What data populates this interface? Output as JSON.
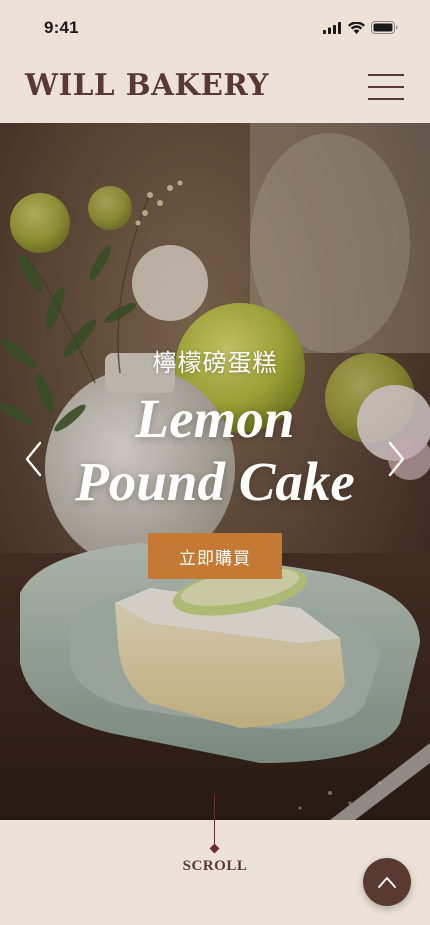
{
  "status_bar": {
    "time": "9:41",
    "icons": [
      "cellular-signal-icon",
      "wifi-icon",
      "battery-icon"
    ]
  },
  "header": {
    "logo": "WILL BAKERY",
    "menu_icon": "hamburger-menu-icon"
  },
  "hero": {
    "subtitle": "檸檬磅蛋糕",
    "title_line1": "Lemon",
    "title_line2": "Pound Cake",
    "cta_label": "立即購買",
    "prev_icon": "chevron-left-icon",
    "next_icon": "chevron-right-icon"
  },
  "scroll_indicator": {
    "label": "SCROLL"
  },
  "back_to_top": {
    "icon": "chevron-up-icon"
  },
  "colors": {
    "background": "#ece2d8",
    "brand_brown": "#5a3a30",
    "cta_orange": "#c47a35",
    "scroll_line": "#6e2f2f"
  }
}
